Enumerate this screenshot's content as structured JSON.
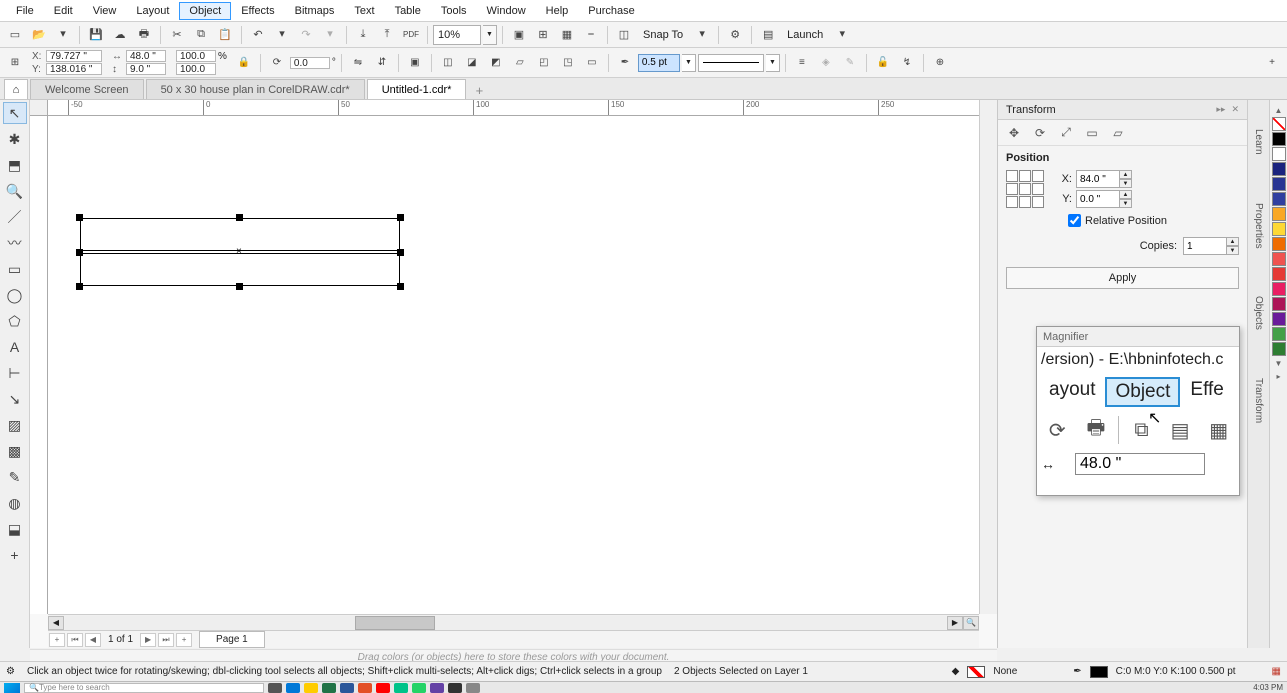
{
  "menubar": [
    "File",
    "Edit",
    "View",
    "Layout",
    "Object",
    "Effects",
    "Bitmaps",
    "Text",
    "Table",
    "Tools",
    "Window",
    "Help",
    "Purchase"
  ],
  "menubar_active_index": 4,
  "toolbar": {
    "zoom": "10%",
    "snap_label": "Snap To",
    "launch_label": "Launch"
  },
  "propbar": {
    "x": "79.727 \"",
    "y": "138.016 \"",
    "w": "48.0 \"",
    "h": "9.0 \"",
    "sx": "100.0",
    "sy": "100.0",
    "angle": "0.0",
    "outline_width": "0.5 pt"
  },
  "tabs": {
    "items": [
      "Welcome Screen",
      "50 x 30 house plan in CorelDRAW.cdr*",
      "Untitled-1.cdr*"
    ],
    "active_index": 2
  },
  "ruler_ticks": [
    -50,
    0,
    50,
    100,
    150,
    200,
    250
  ],
  "transform": {
    "title": "Transform",
    "section": "Position",
    "x": "84.0 \"",
    "y": "0.0 \"",
    "relative_label": "Relative Position",
    "relative_checked": true,
    "copies_label": "Copies:",
    "copies": "1",
    "apply": "Apply"
  },
  "magnifier": {
    "title": "Magnifier",
    "line1": "/ersion) - E:\\hbninfotech.c",
    "menu": [
      "ayout",
      "Object",
      "Effe"
    ],
    "menu_hl_index": 1,
    "value": "48.0 \""
  },
  "vtabs": [
    "Learn",
    "Properties",
    "Objects",
    "Transform"
  ],
  "palette": [
    "transparent",
    "#000000",
    "#ffffff",
    "#1a237e",
    "#283593",
    "#303f9f",
    "#f9a825",
    "#fdd835",
    "#ef5350",
    "#e53935",
    "#c62828",
    "#43a047",
    "#2e7d32"
  ],
  "pages": {
    "info": "1 of 1",
    "tab": "Page 1"
  },
  "colorstore_hint": "Drag colors (or objects) here to store these colors with your document.",
  "status": {
    "hint": "Click an object twice for rotating/skewing; dbl-clicking tool selects all objects; Shift+click multi-selects; Alt+click digs; Ctrl+click selects in a group",
    "selection": "2 Objects Selected on Layer 1",
    "fill_label": "None",
    "outline_info": "C:0 M:0 Y:0 K:100  0.500 pt"
  },
  "taskbar": {
    "search_placeholder": "Type here to search",
    "time": "4:03 PM"
  }
}
